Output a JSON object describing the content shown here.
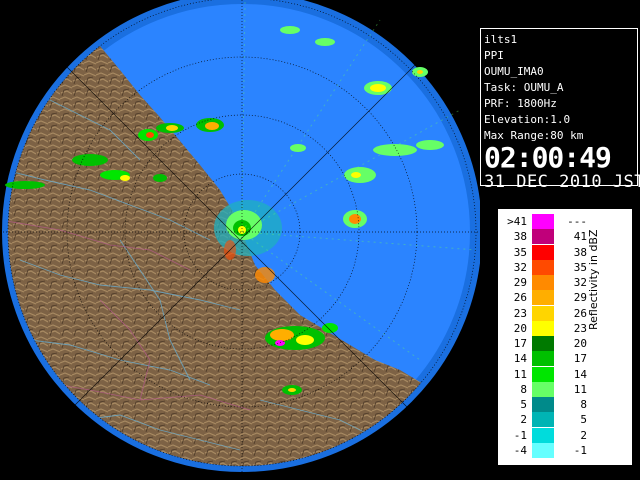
{
  "radar": {
    "site": "ilts1",
    "product": "PPI",
    "station": "OUMU_IMA0",
    "task": "Task: OUMU_A",
    "prf": "PRF: 1800Hz",
    "elevation": "Elevation:1.0",
    "max_range": "Max Range:80 km",
    "time": "02:00:49",
    "date": "31 DEC 2010 JST"
  },
  "legend": {
    "unit": "Reflectivity in dBZ",
    "rows": [
      {
        "lo": ">41",
        "hi": "---",
        "color": "#ff00ff"
      },
      {
        "lo": "38",
        "hi": "41",
        "color": "#c0007a"
      },
      {
        "lo": "35",
        "hi": "38",
        "color": "#ff0000"
      },
      {
        "lo": "32",
        "hi": "35",
        "color": "#ff4a00"
      },
      {
        "lo": "29",
        "hi": "32",
        "color": "#ff8a00"
      },
      {
        "lo": "26",
        "hi": "29",
        "color": "#ffae00"
      },
      {
        "lo": "23",
        "hi": "26",
        "color": "#ffd500"
      },
      {
        "lo": "20",
        "hi": "23",
        "color": "#ffff00"
      },
      {
        "lo": "17",
        "hi": "20",
        "color": "#007a00"
      },
      {
        "lo": "14",
        "hi": "17",
        "color": "#00c000"
      },
      {
        "lo": "11",
        "hi": "14",
        "color": "#00e600"
      },
      {
        "lo": "8",
        "hi": "11",
        "color": "#66ff66"
      },
      {
        "lo": "5",
        "hi": "8",
        "color": "#008a8a"
      },
      {
        "lo": "2",
        "hi": "5",
        "color": "#00b4b4"
      },
      {
        "lo": "-1",
        "hi": "2",
        "color": "#00dcdc"
      },
      {
        "lo": "-4",
        "hi": "-1",
        "color": "#66ffff"
      }
    ]
  },
  "colors": {
    "sea": "#2b84ff",
    "land": "#8a6e4c",
    "range_ring_outer": "#1a6fe0"
  }
}
